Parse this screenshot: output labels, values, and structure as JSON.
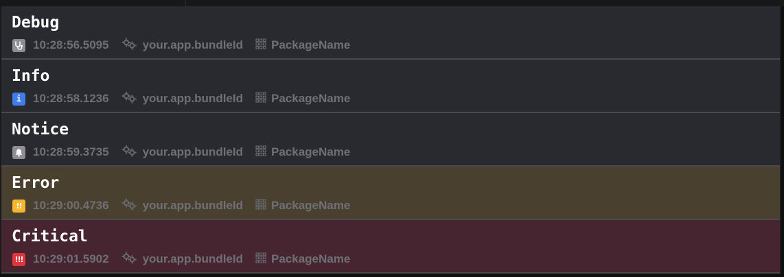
{
  "log": {
    "entries": [
      {
        "level": "Debug",
        "badge_icon": "stethoscope-icon",
        "badge_text": "",
        "badge_color": "#8e8e93",
        "row_background": "#292a2f",
        "timestamp": "10:28:56.5095",
        "bundle_id": "your.app.bundleId",
        "package": "PackageName"
      },
      {
        "level": "Info",
        "badge_icon": "info-icon",
        "badge_text": "i",
        "badge_color": "#3f7ee8",
        "row_background": "#292a2f",
        "timestamp": "10:28:58.1236",
        "bundle_id": "your.app.bundleId",
        "package": "PackageName"
      },
      {
        "level": "Notice",
        "badge_icon": "bell-icon",
        "badge_text": "",
        "badge_color": "#8e8e93",
        "row_background": "#292a2f",
        "timestamp": "10:28:59.3735",
        "bundle_id": "your.app.bundleId",
        "package": "PackageName"
      },
      {
        "level": "Error",
        "badge_icon": "double-exclamation-icon",
        "badge_text": "!!",
        "badge_color": "#f5b730",
        "row_background": "#4a4030",
        "timestamp": "10:29:00.4736",
        "bundle_id": "your.app.bundleId",
        "package": "PackageName"
      },
      {
        "level": "Critical",
        "badge_icon": "triple-exclamation-icon",
        "badge_text": "!!!",
        "badge_color": "#e0353a",
        "row_background": "#472530",
        "timestamp": "10:29:01.5902",
        "bundle_id": "your.app.bundleId",
        "package": "PackageName"
      }
    ],
    "meta_icons": {
      "bundle": "gears-icon",
      "package": "package-grid-icon"
    }
  }
}
